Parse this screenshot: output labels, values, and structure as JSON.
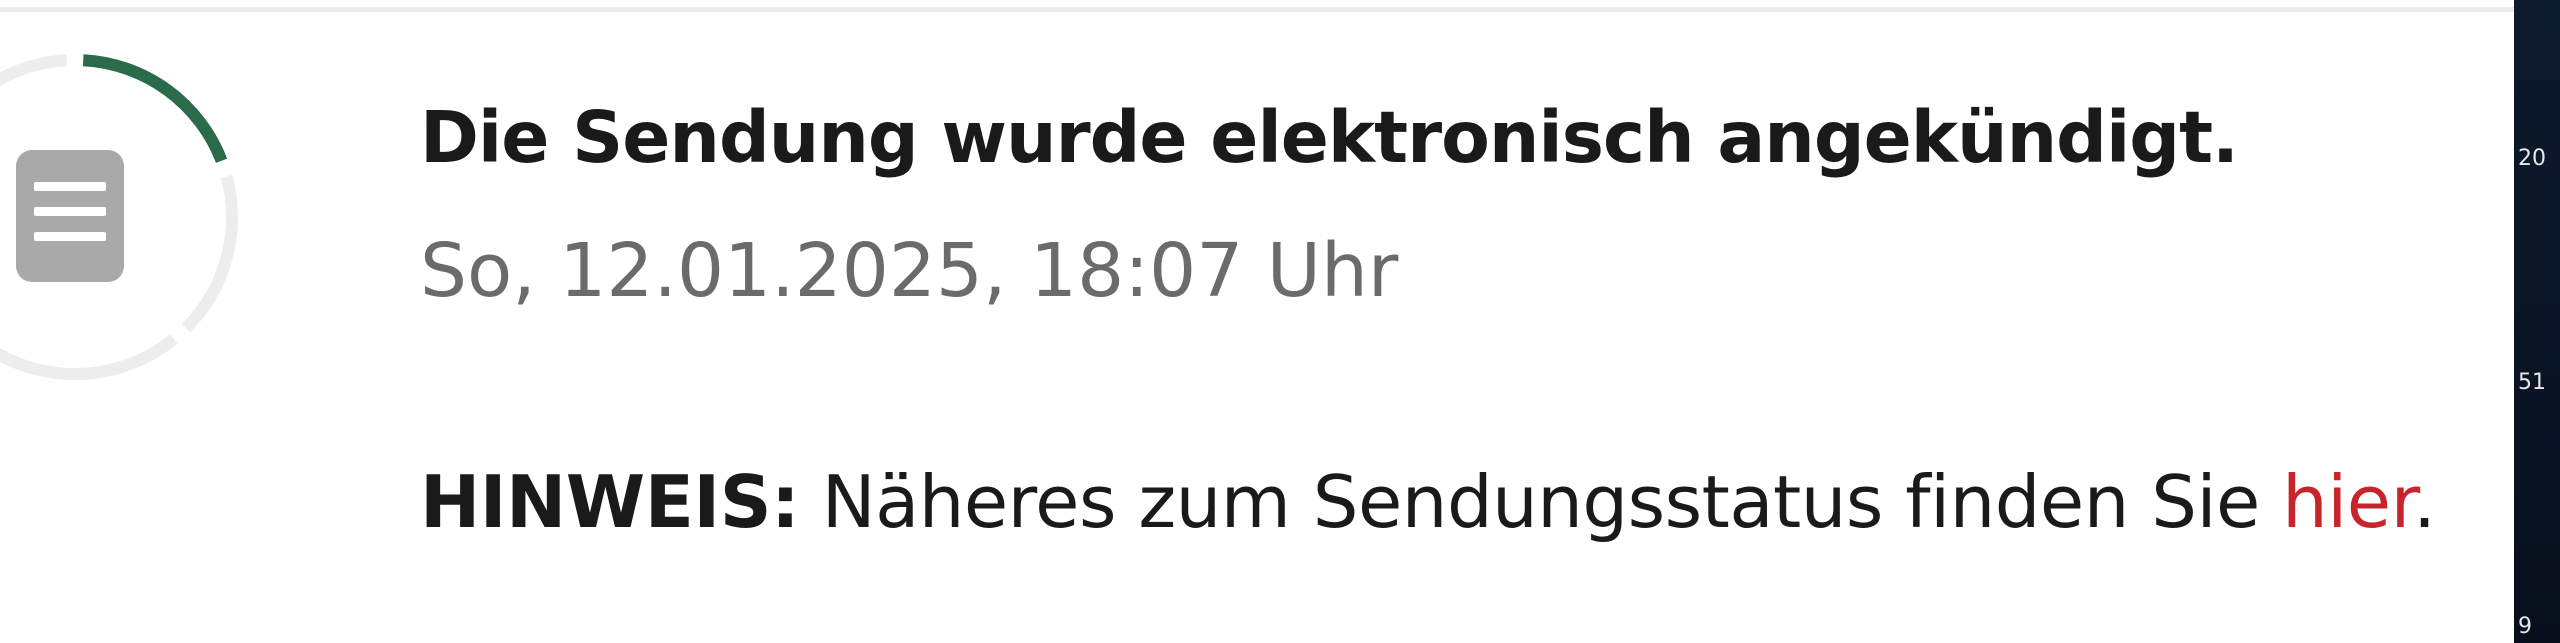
{
  "status": {
    "icon": "document-icon",
    "progress_fraction": 0.2,
    "ring_color": "#2a6b4a",
    "title": "Die Sendung wurde elektronisch angekündigt.",
    "datetime": "So, 12.01.2025, 18:07 Uhr"
  },
  "hint": {
    "label": "HINWEIS:",
    "text": " Näheres zum Sendungsstatus finden Sie ",
    "link_text": "hier",
    "suffix": ".",
    "link_color": "#c8242b"
  },
  "side_strip": {
    "numbers": [
      "20",
      "51",
      "9"
    ]
  }
}
